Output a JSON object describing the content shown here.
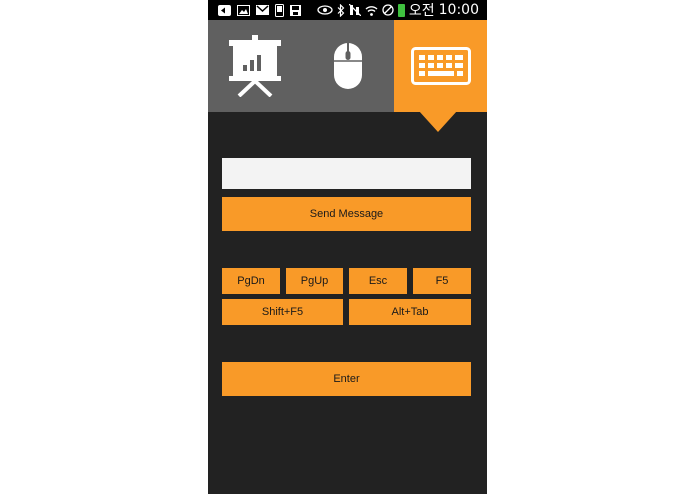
{
  "status_bar": {
    "carrier_label": "오전",
    "time": "10:00",
    "battery_color": "#3fc13f",
    "left_icons": [
      "expand-icon",
      "gallery-icon",
      "gmail-icon",
      "phone-icon",
      "save-icon"
    ],
    "right_icons": [
      "eye-icon",
      "bluetooth-icon",
      "mute-icon",
      "wifi-icon",
      "blocked-icon",
      "battery-icon"
    ]
  },
  "tabs": [
    {
      "name": "presentation",
      "icon": "presentation-icon",
      "active": false
    },
    {
      "name": "mouse",
      "icon": "mouse-icon",
      "active": false
    },
    {
      "name": "keyboard",
      "icon": "keyboard-icon",
      "active": true
    }
  ],
  "message": {
    "value": "",
    "placeholder": "",
    "send_label": "Send Message"
  },
  "keys": {
    "pgdn": "PgDn",
    "pgup": "PgUp",
    "esc": "Esc",
    "f5": "F5",
    "shift_f5": "Shift+F5",
    "alt_tab": "Alt+Tab",
    "enter": "Enter"
  },
  "colors": {
    "accent": "#f99a28",
    "tab_bg": "#606060",
    "background": "#222222",
    "input_bg": "#f3f3f3"
  }
}
